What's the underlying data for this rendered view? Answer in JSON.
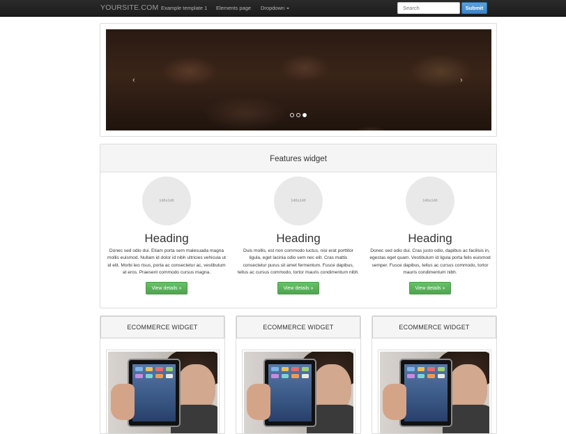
{
  "navbar": {
    "brand": "YOURSITE.COM",
    "links": [
      "Example template 1",
      "Elements page",
      "Dropdown"
    ],
    "search_placeholder": "Search",
    "submit_label": "Submit"
  },
  "carousel": {
    "prev_glyph": "‹",
    "next_glyph": "›",
    "slide_count": 3,
    "active_slide": 3
  },
  "features": {
    "title": "Features widget",
    "items": [
      {
        "image_label": "140x140",
        "heading": "Heading",
        "text": "Donec sed odio dui. Etiam porta sem malesuada magna mollis euismod. Nullam id dolor id nibh ultricies vehicula ut id elit. Morbi leo risus, porta ac consectetur ac, vestibulum at eros. Praesent commodo cursus magna.",
        "button": "View details »"
      },
      {
        "image_label": "140x140",
        "heading": "Heading",
        "text": "Duis mollis, est non commodo luctus, nisi erat porttitor ligula, eget lacinia odio sem nec elit. Cras mattis consectetur purus sit amet fermentum. Fusce dapibus, tellus ac cursus commodo, tortor mauris condimentum nibh.",
        "button": "View details »"
      },
      {
        "image_label": "140x140",
        "heading": "Heading",
        "text": "Donec sed odio dui. Cras justo odio, dapibus ac facilisis in, egestas eget quam. Vestibulum id ligula porta felis euismod semper. Fusce dapibus, tellus ac cursus commodo, tortor mauris condimentum nibh.",
        "button": "View details »"
      }
    ]
  },
  "ecommerce": [
    {
      "title": "ECOMMERCE WIDGET"
    },
    {
      "title": "ECOMMERCE WIDGET"
    },
    {
      "title": "ECOMMERCE WIDGET"
    }
  ],
  "colors": {
    "navbar_bg": "#222222",
    "primary_button": "#428bca",
    "success_button": "#5cb85c",
    "panel_header": "#f5f5f5"
  }
}
